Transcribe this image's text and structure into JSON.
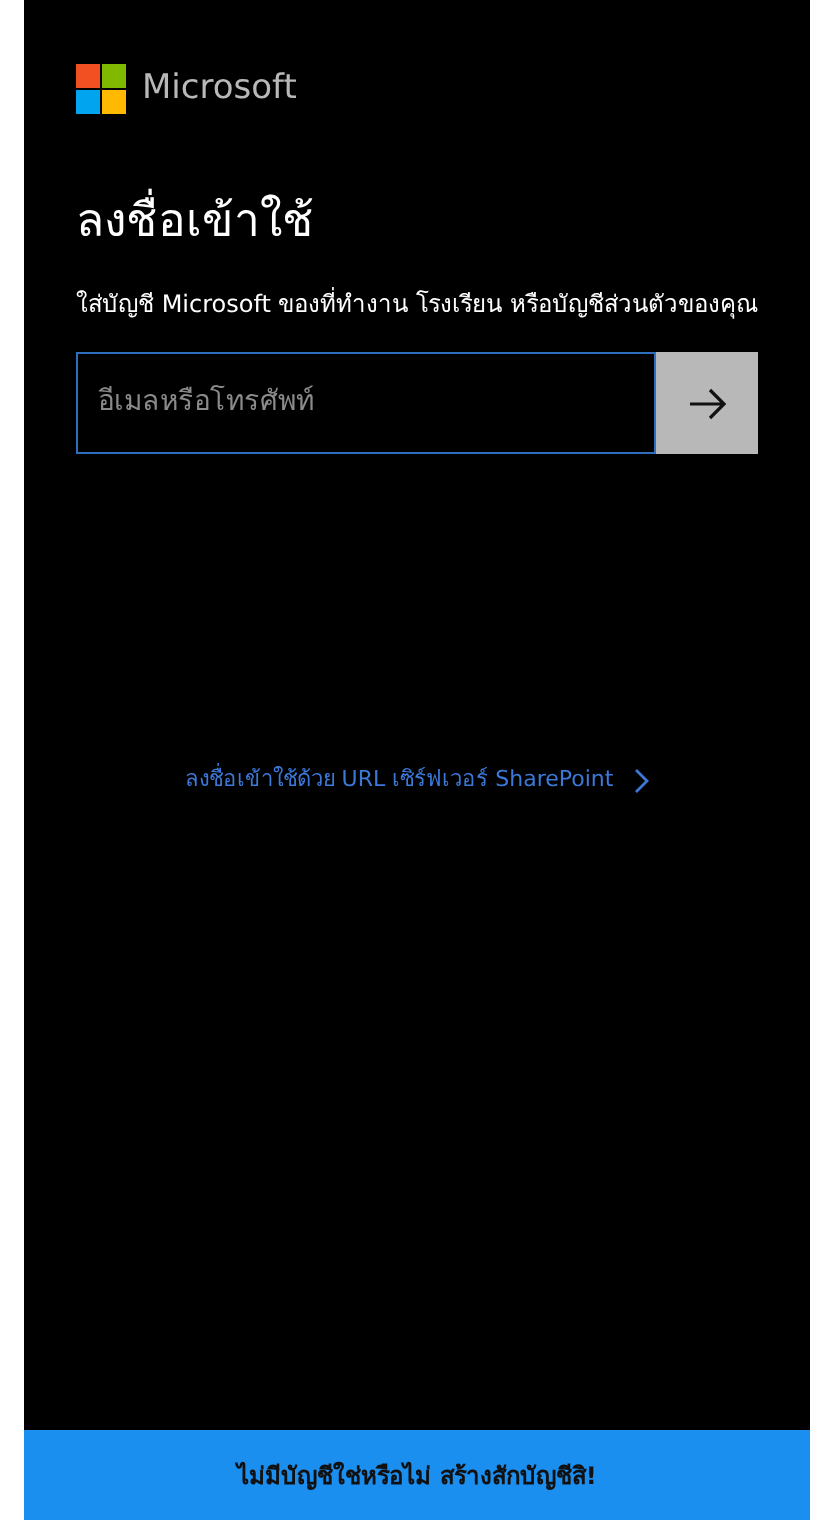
{
  "logo": {
    "text": "Microsoft"
  },
  "title": "ลงชื่อเข้าใช้",
  "description": "ใส่บัญชี Microsoft ของที่ทำงาน โรงเรียน หรือบัญชีส่วนตัวของคุณ",
  "email_field": {
    "placeholder": "อีเมลหรือโทรศัพท์"
  },
  "sharepoint_link": "ลงชื่อเข้าใช้ด้วย URL เซิร์ฟเวอร์ SharePoint",
  "footer": "ไม่มีบัญชีใช่หรือไม่ สร้างสักบัญชีสิ!"
}
